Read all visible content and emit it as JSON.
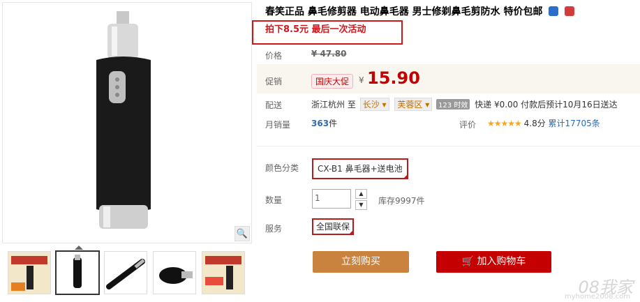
{
  "product": {
    "title": "春笑正品 鼻毛修剪器 电动鼻毛器 男士修剃鼻毛剪防水 特价包邮",
    "promo": "拍下8.5元 最后一次活动",
    "price_label": "价格",
    "original_price": "¥ 47.80",
    "promo_label": "促销",
    "promo_tag": "国庆大促",
    "currency": "¥",
    "price": "15.90",
    "shipping_label": "配送",
    "ship_from": "浙江杭州",
    "ship_to": "至",
    "city": "长沙",
    "district": "芙蓉区",
    "timely_badge": "123 时效",
    "express": "快递 ¥0.00 付款后预计10月16日送达",
    "monthly_label": "月销量",
    "monthly_sales": "363",
    "sales_unit": "件",
    "rating_label": "评价",
    "stars": "★★★★★",
    "rating_score": "4.8分",
    "reviews": "累计17705条",
    "color_label": "颜色分类",
    "color_option": "CX-B1 鼻毛器+送电池",
    "qty_label": "数量",
    "qty_value": "1",
    "stock": "库存9997件",
    "service_label": "服务",
    "service_option": "全国联保",
    "buy_now": "立刻购买",
    "add_cart": "加入购物车",
    "watermark": "08我家",
    "watermark_sub": "myhome2008.com"
  },
  "icons": [
    "magnifier-icon",
    "cart-icon",
    "shield-badge-icon",
    "heart-badge-icon"
  ]
}
